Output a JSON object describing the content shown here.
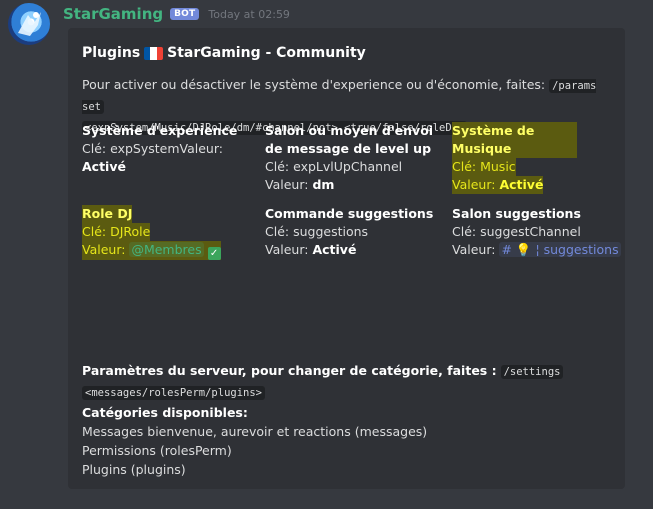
{
  "message": {
    "username": "StarGaming",
    "bot_tag": "BOT",
    "timestamp": "Today at 02:59"
  },
  "embed": {
    "title_prefix": "Plugins",
    "title_flag": "french-flag",
    "title_suffix": "StarGaming - Community",
    "description_text": "Pour activer ou désactiver le système d'experience ou d'économie, faites:",
    "description_code1": "/params set",
    "description_code2": "<expSystem/Music/DJRole/dm/#channel/not> <true/false/roleDJ>",
    "fields": [
      {
        "name": "Système d'experience",
        "key_label": "Clé:",
        "key": "expSystem",
        "value_label": "Valeur:",
        "value": "Activé"
      },
      {
        "name": "Salon ou moyen d'envoi de message de level up",
        "key_label": "Clé:",
        "key": "expLvlUpChannel",
        "value_label": "Valeur:",
        "value": "dm"
      },
      {
        "name": "Système de Musique",
        "key_label": "Clé:",
        "key": "Music",
        "value_label": "Valeur:",
        "value": "Activé"
      },
      {
        "name": "Role DJ",
        "key_label": "Clé:",
        "key": "DJRole",
        "value_label": "Valeur:",
        "value": "@Membres"
      },
      {
        "name": "Commande suggestions",
        "key_label": "Clé:",
        "key": "suggestions",
        "value_label": "Valeur:",
        "value": "Activé"
      },
      {
        "name": "Salon suggestions",
        "key_label": "Clé:",
        "key": "suggestChannel",
        "value_label": "Valeur:",
        "value": "# 💡 ¦ suggestions"
      }
    ],
    "footer": {
      "settings_text": "Paramètres du serveur, pour changer de catégorie, faites :",
      "settings_code1": "/settings",
      "settings_code2": "<messages/rolesPerm/plugins>",
      "categories_title": "Catégories disponibles:",
      "categories": [
        "Messages bienvenue, aurevoir et reactions (messages)",
        "Permissions (rolesPerm)",
        "Plugins (plugins)"
      ]
    }
  },
  "colors": {
    "background": "#36393f",
    "embed_background": "#2f3136",
    "username": "#43b581",
    "bot_tag": "#7289da",
    "highlight": "#ffff00"
  }
}
